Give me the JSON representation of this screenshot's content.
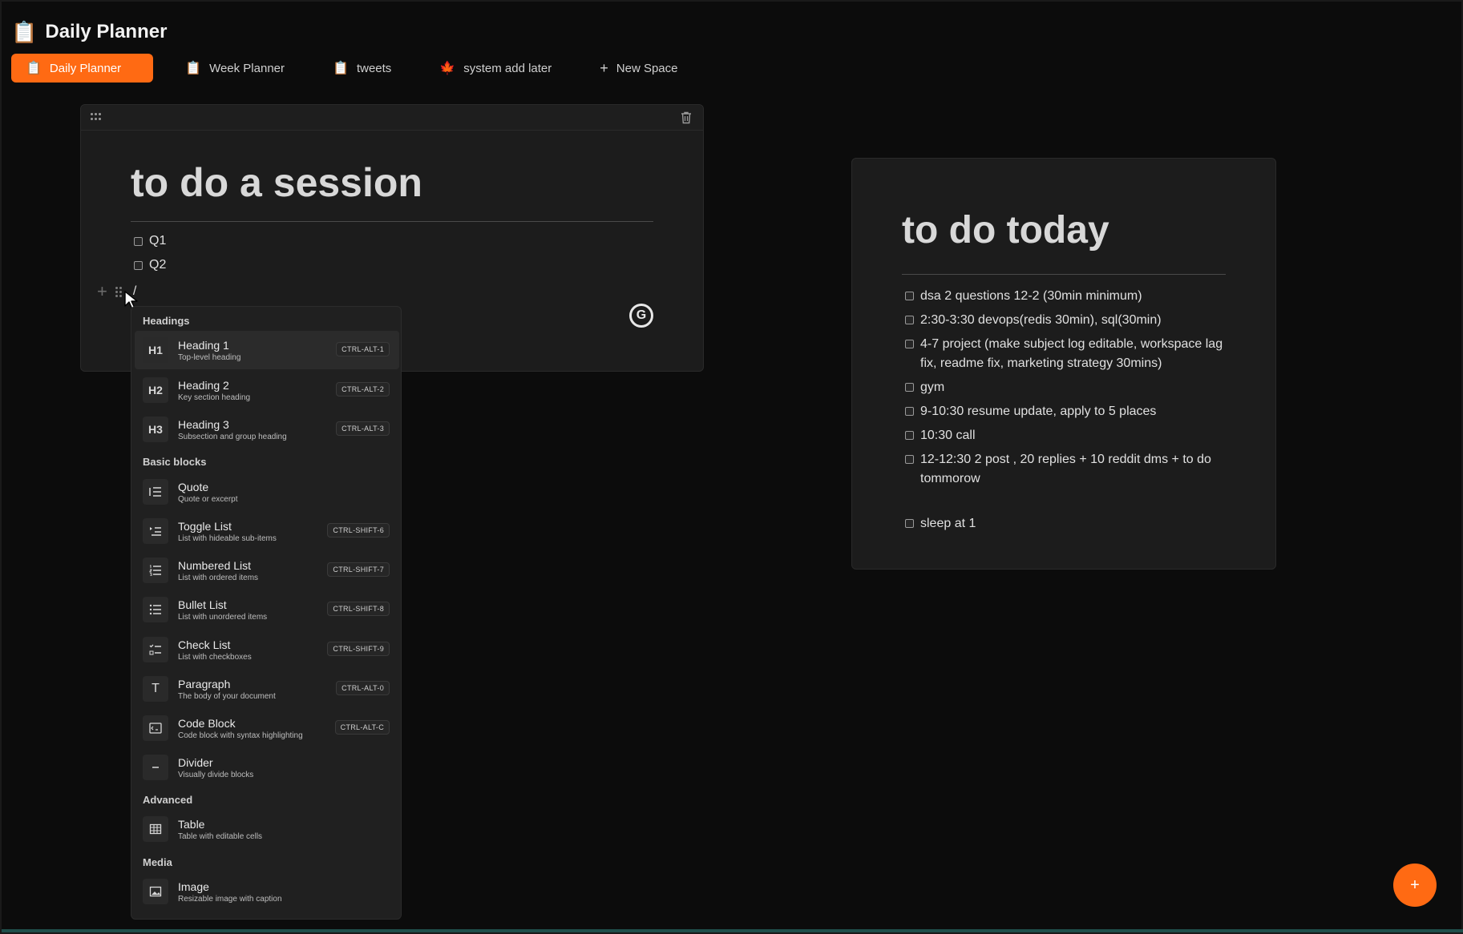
{
  "app": {
    "emoji": "📋",
    "title": "Daily Planner"
  },
  "tabs": [
    {
      "icon": "📋",
      "label": "Daily Planner",
      "active": true
    },
    {
      "icon": "📋",
      "label": "Week Planner"
    },
    {
      "icon": "📋",
      "label": "tweets"
    },
    {
      "icon": "🍁",
      "label": "system add later"
    },
    {
      "icon": "+",
      "label": "New Space"
    }
  ],
  "session_card": {
    "title": "to do a session",
    "items": [
      "Q1",
      "Q2"
    ],
    "slash_text": "/"
  },
  "slash_menu": {
    "sections": {
      "headings": "Headings",
      "basic": "Basic blocks",
      "advanced": "Advanced",
      "media": "Media"
    },
    "items": [
      {
        "icon": "H1",
        "name": "Heading 1",
        "desc": "Top-level heading",
        "kbd": "CTRL-ALT-1"
      },
      {
        "icon": "H2",
        "name": "Heading 2",
        "desc": "Key section heading",
        "kbd": "CTRL-ALT-2"
      },
      {
        "icon": "H3",
        "name": "Heading 3",
        "desc": "Subsection and group heading",
        "kbd": "CTRL-ALT-3"
      },
      {
        "icon": "quote-icon",
        "name": "Quote",
        "desc": "Quote or excerpt",
        "kbd": ""
      },
      {
        "icon": "toggle-list-icon",
        "name": "Toggle List",
        "desc": "List with hideable sub-items",
        "kbd": "CTRL-SHIFT-6"
      },
      {
        "icon": "numbered-list-icon",
        "name": "Numbered List",
        "desc": "List with ordered items",
        "kbd": "CTRL-SHIFT-7"
      },
      {
        "icon": "bullet-list-icon",
        "name": "Bullet List",
        "desc": "List with unordered items",
        "kbd": "CTRL-SHIFT-8"
      },
      {
        "icon": "check-list-icon",
        "name": "Check List",
        "desc": "List with checkboxes",
        "kbd": "CTRL-SHIFT-9"
      },
      {
        "icon": "T",
        "name": "Paragraph",
        "desc": "The body of your document",
        "kbd": "CTRL-ALT-0"
      },
      {
        "icon": "code-icon",
        "name": "Code Block",
        "desc": "Code block with syntax highlighting",
        "kbd": "CTRL-ALT-C"
      },
      {
        "icon": "divider-icon",
        "name": "Divider",
        "desc": "Visually divide blocks",
        "kbd": ""
      },
      {
        "icon": "table-icon",
        "name": "Table",
        "desc": "Table with editable cells",
        "kbd": ""
      },
      {
        "icon": "image-icon",
        "name": "Image",
        "desc": "Resizable image with caption",
        "kbd": ""
      }
    ]
  },
  "today_card": {
    "title": "to do today",
    "items": [
      "dsa 2 questions 12-2 (30min minimum)",
      "2:30-3:30 devops(redis 30min), sql(30min)",
      "4-7 project (make subject log editable, workspace lag fix, readme fix, marketing strategy 30mins)",
      "gym",
      "9-10:30  resume update, apply to 5 places",
      "10:30 call",
      "12-12:30 2 post , 20 replies + 10 reddit dms + to do tommorow",
      "sleep at 1"
    ]
  },
  "fab_label": "+",
  "grammarly_label": "G",
  "colors": {
    "accent": "#ff6a13",
    "background": "#0c0c0c",
    "card": "#1c1c1c"
  }
}
